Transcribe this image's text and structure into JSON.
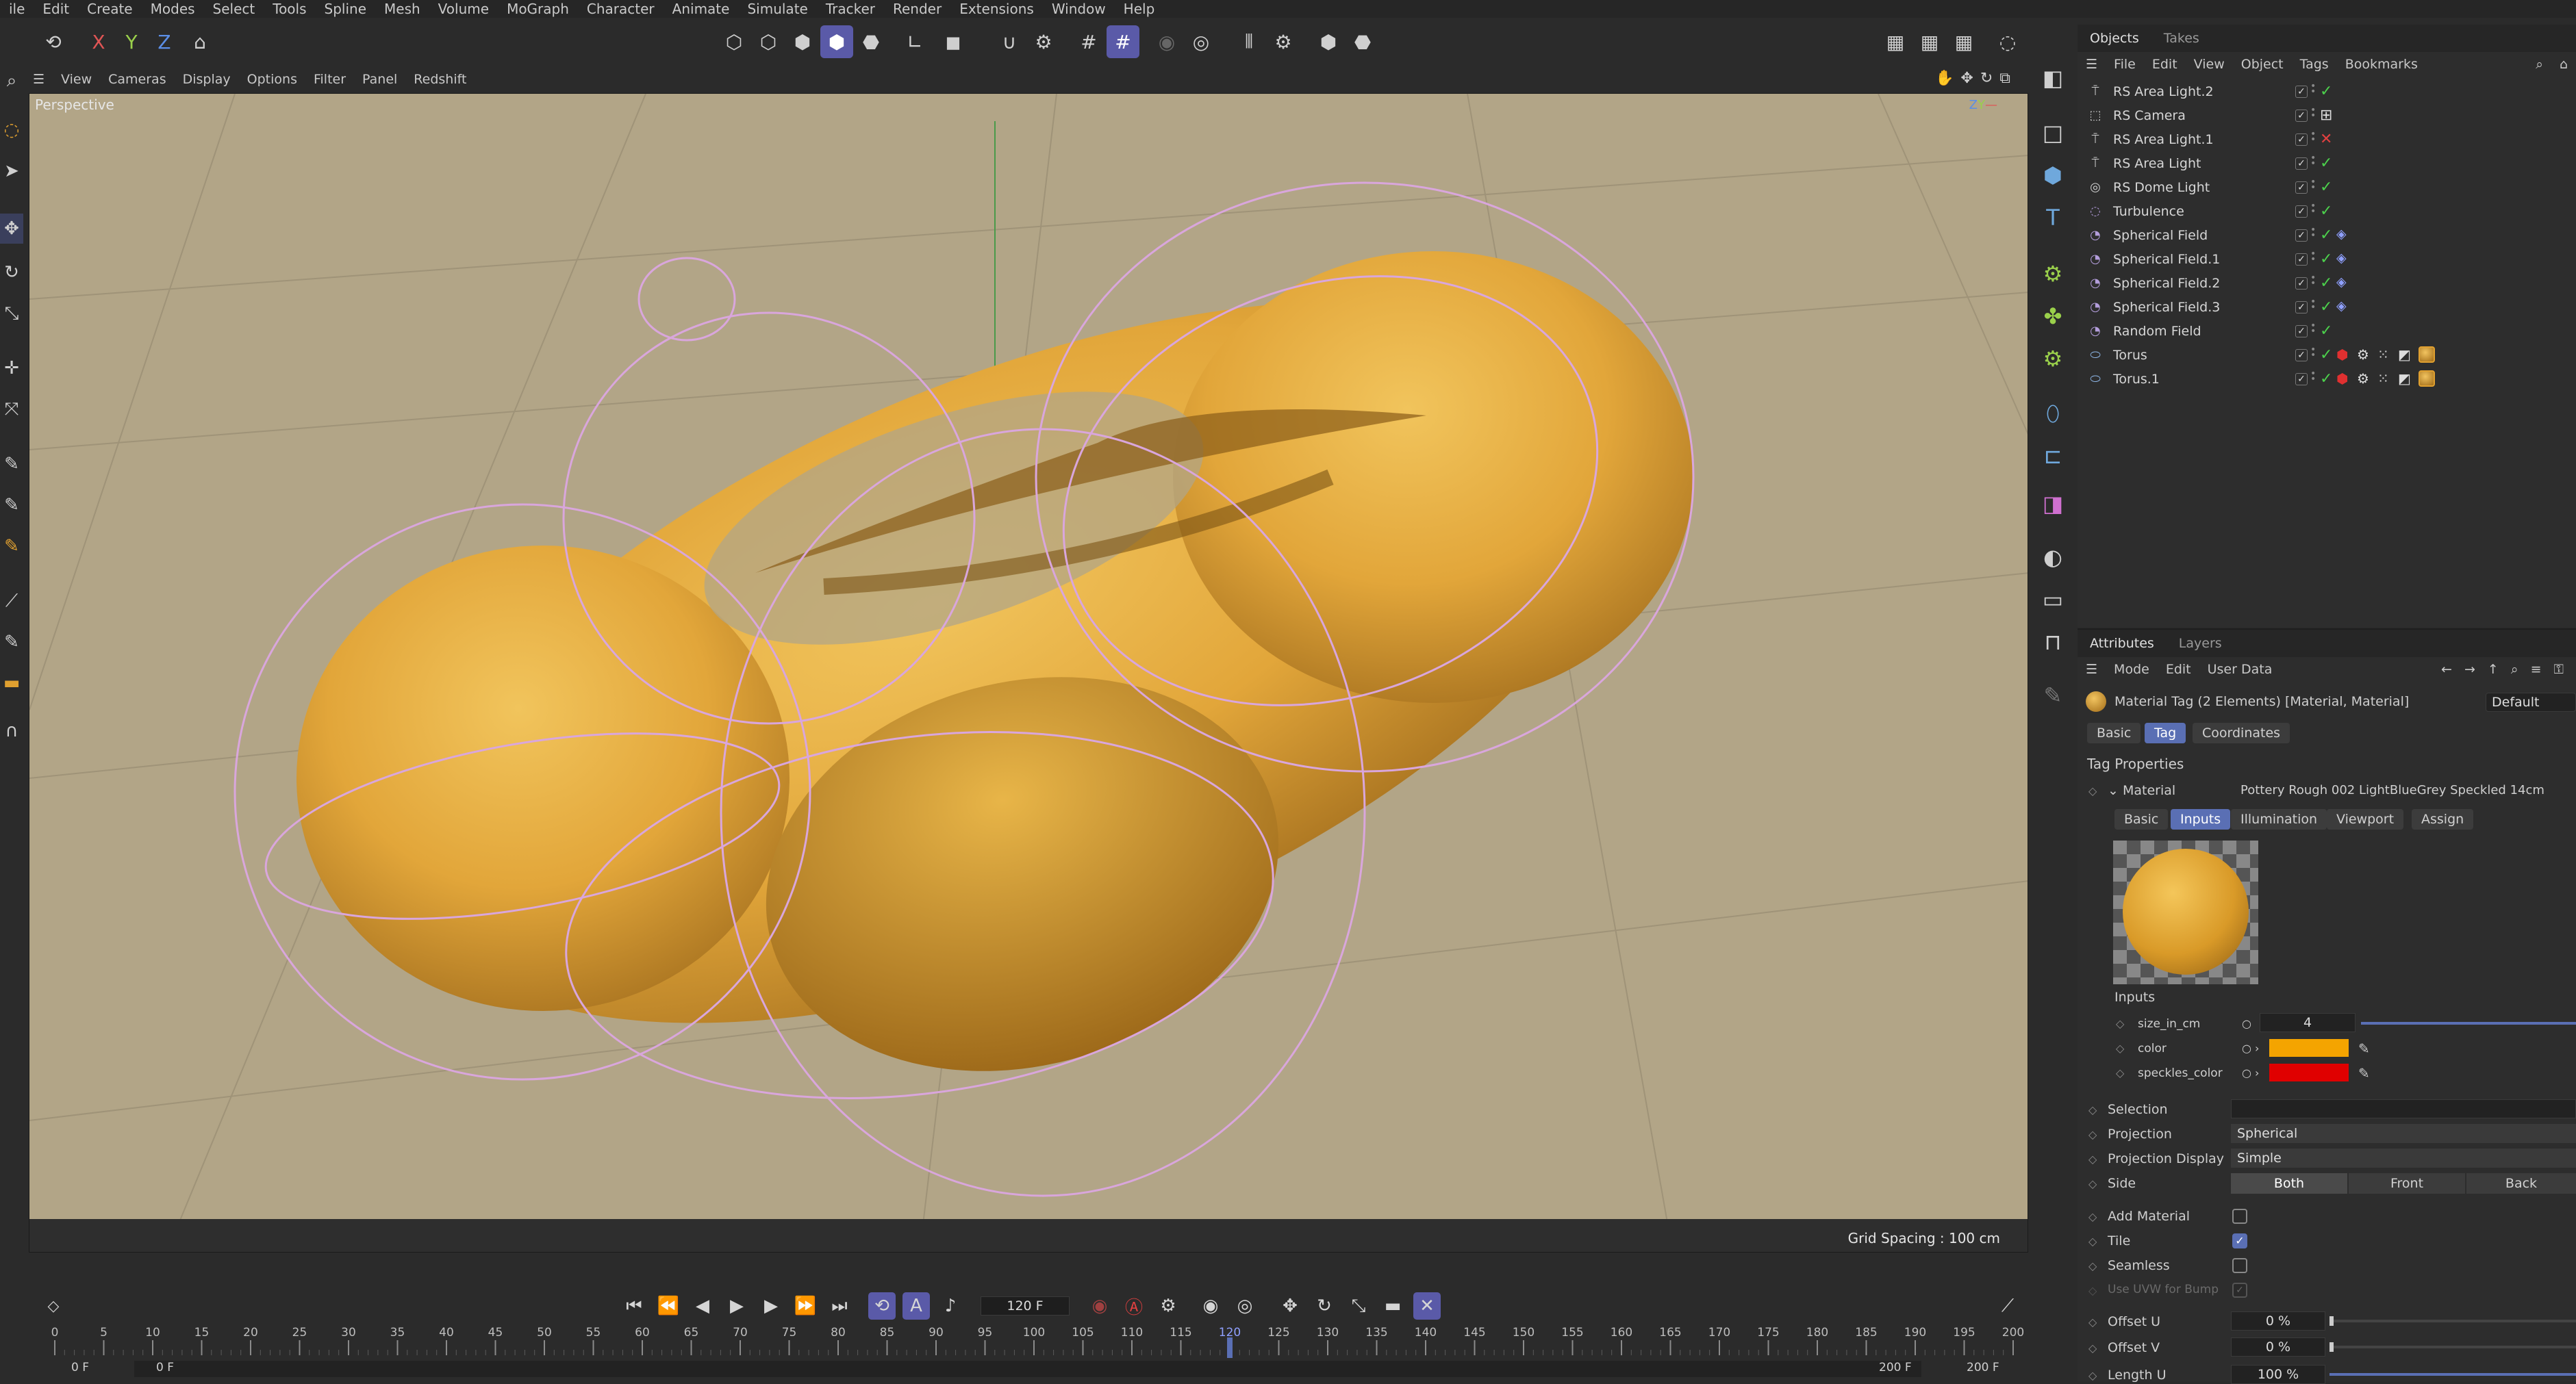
{
  "menu": [
    "ile",
    "Edit",
    "Create",
    "Modes",
    "Select",
    "Tools",
    "Spline",
    "Mesh",
    "Volume",
    "MoGraph",
    "Character",
    "Animate",
    "Simulate",
    "Tracker",
    "Render",
    "Extensions",
    "Window",
    "Help"
  ],
  "toolbar": {
    "x": "X",
    "y": "Y",
    "z": "Z"
  },
  "viewport": {
    "menu": [
      "View",
      "Cameras",
      "Display",
      "Options",
      "Filter",
      "Panel",
      "Redshift"
    ],
    "label": "Perspective",
    "grid_spacing": "Grid Spacing : 100 cm",
    "background": "#b2a587",
    "object_color": "#e6a93a"
  },
  "objects": {
    "tabs": [
      "Objects",
      "Takes"
    ],
    "menu": [
      "File",
      "Edit",
      "View",
      "Object",
      "Tags",
      "Bookmarks"
    ],
    "items": [
      {
        "name": "RS Area Light.2",
        "icon": "light-icon",
        "state": "check"
      },
      {
        "name": "RS Camera",
        "icon": "camera-icon",
        "state": "target"
      },
      {
        "name": "RS Area Light.1",
        "icon": "light-icon",
        "state": "cross"
      },
      {
        "name": "RS Area Light",
        "icon": "light-icon",
        "state": "check"
      },
      {
        "name": "RS Dome Light",
        "icon": "dome-light-icon",
        "state": "check"
      },
      {
        "name": "Turbulence",
        "icon": "turbulence-icon",
        "state": "check"
      },
      {
        "name": "Spherical Field",
        "icon": "field-icon",
        "state": "check"
      },
      {
        "name": "Spherical Field.1",
        "icon": "field-icon",
        "state": "check"
      },
      {
        "name": "Spherical Field.2",
        "icon": "field-icon",
        "state": "check"
      },
      {
        "name": "Spherical Field.3",
        "icon": "field-icon",
        "state": "check"
      },
      {
        "name": "Random Field",
        "icon": "field-icon",
        "state": "check"
      },
      {
        "name": "Torus",
        "icon": "torus-icon",
        "state": "check"
      },
      {
        "name": "Torus.1",
        "icon": "torus-icon",
        "state": "check"
      }
    ]
  },
  "attributes": {
    "tabs": [
      "Attributes",
      "Layers"
    ],
    "menu": [
      "Mode",
      "Edit",
      "User Data"
    ],
    "title": "Material Tag (2 Elements) [Material, Material]",
    "preset": "Default",
    "subtabs": [
      "Basic",
      "Tag",
      "Coordinates"
    ],
    "section": "Tag Properties",
    "material_label": "Material",
    "material_value": "Pottery Rough 002 LightBlueGrey Speckled 14cm",
    "mat_tabs": [
      "Basic",
      "Inputs",
      "Illumination",
      "Viewport",
      "Assign"
    ],
    "inputs_heading": "Inputs",
    "size_label": "size_in_cm",
    "size_value": "4",
    "color_label": "color",
    "color_hex": "#f4a400",
    "speckles_label": "speckles_color",
    "speckles_hex": "#e00000",
    "selection_label": "Selection",
    "projection_label": "Projection",
    "projection_value": "Spherical",
    "projdisplay_label": "Projection Display",
    "projdisplay_value": "Simple",
    "side_label": "Side",
    "side_options": [
      "Both",
      "Front",
      "Back"
    ],
    "add_material": "Add Material",
    "tile": "Tile",
    "seamless": "Seamless",
    "use_uvw": "Use UVW for Bump",
    "offset_u": "Offset U",
    "offset_u_val": "0 %",
    "offset_v": "Offset V",
    "offset_v_val": "0 %",
    "length_u": "Length U",
    "length_u_val": "100 %"
  },
  "timeline": {
    "current_frame": "120 F",
    "ticks": [
      "0",
      "5",
      "10",
      "15",
      "20",
      "25",
      "30",
      "35",
      "40",
      "45",
      "50",
      "55",
      "60",
      "65",
      "70",
      "75",
      "80",
      "85",
      "90",
      "95",
      "100",
      "105",
      "110",
      "115",
      "120",
      "125",
      "130",
      "135",
      "140",
      "145",
      "150",
      "155",
      "160",
      "165",
      "170",
      "175",
      "180",
      "185",
      "190",
      "195",
      "200"
    ],
    "start": "0 F",
    "start2": "0 F",
    "end": "200 F",
    "end2": "200 F"
  }
}
